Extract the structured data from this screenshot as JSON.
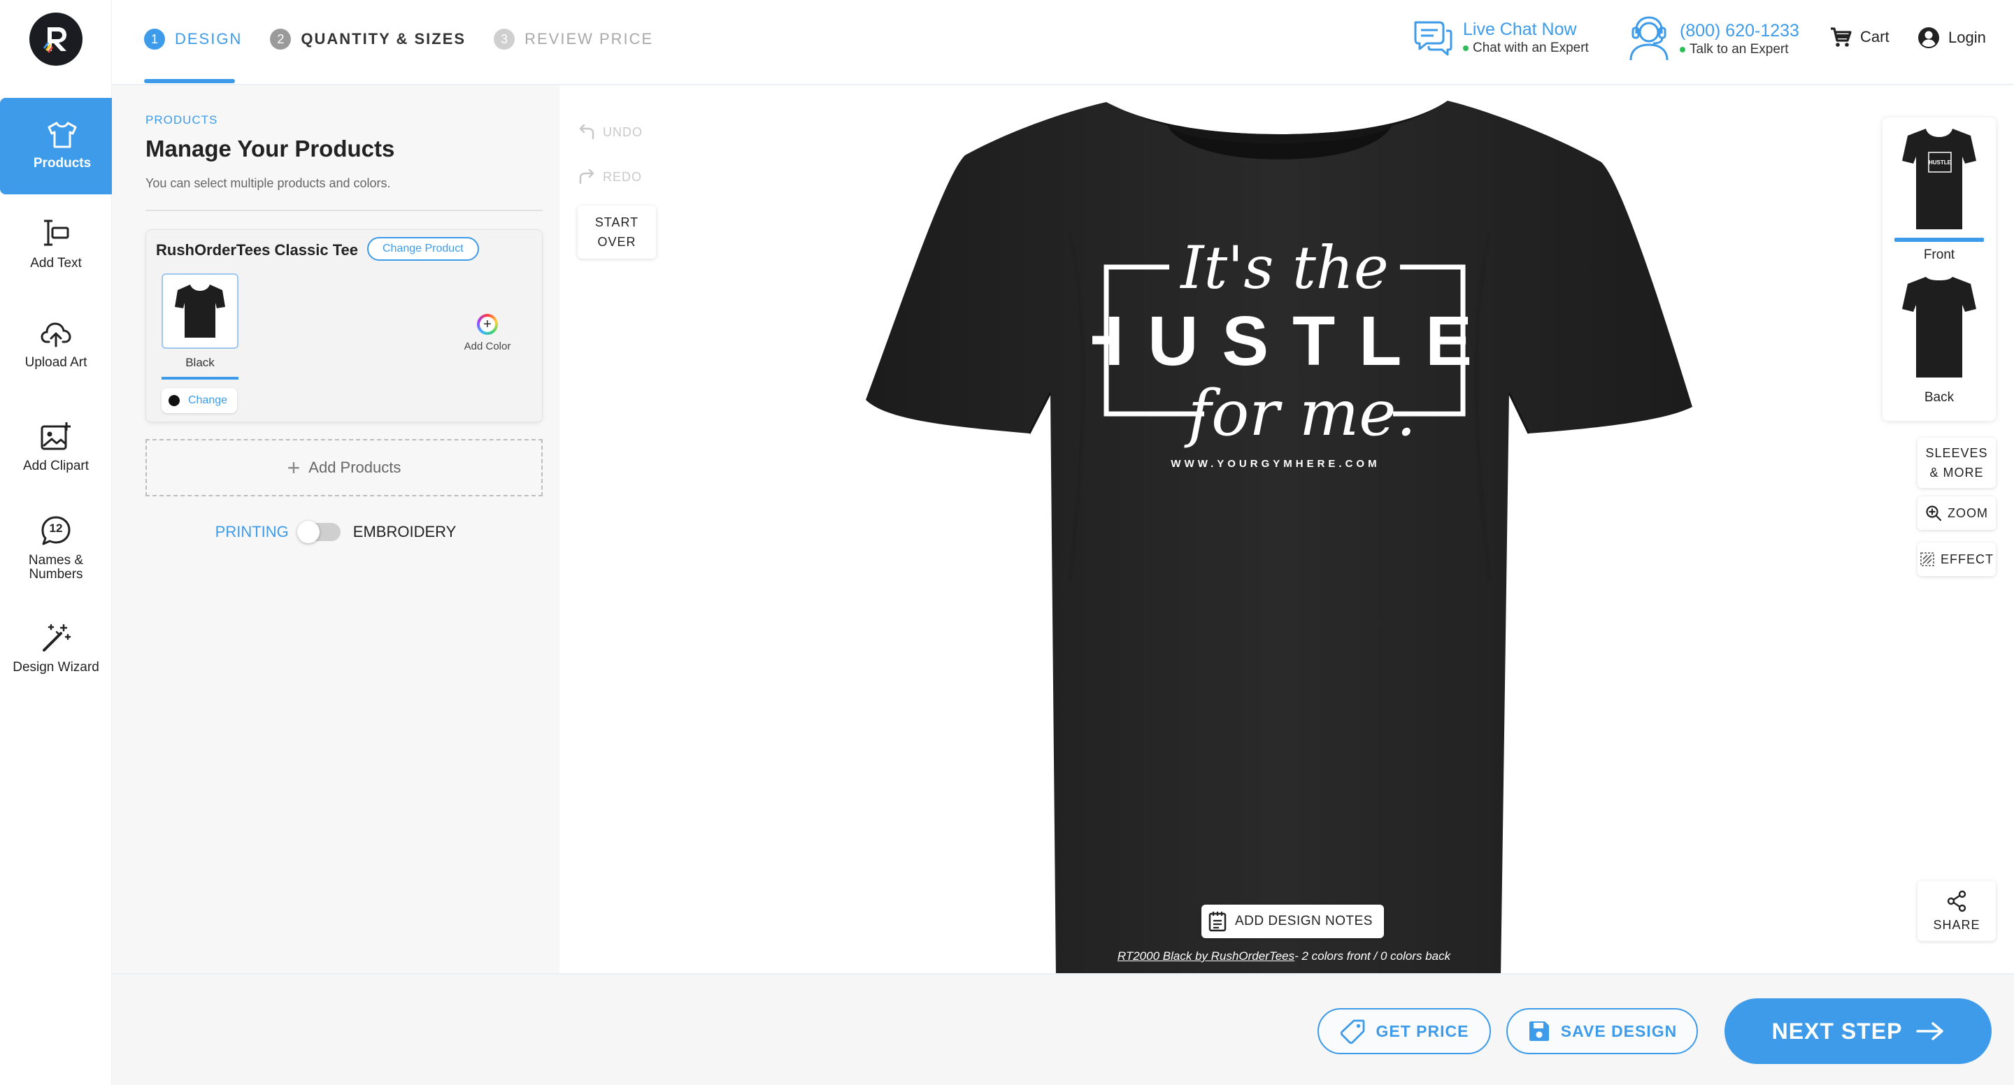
{
  "header": {
    "steps": [
      {
        "num": "1",
        "label": "DESIGN"
      },
      {
        "num": "2",
        "label": "QUANTITY & SIZES"
      },
      {
        "num": "3",
        "label": "REVIEW PRICE"
      }
    ],
    "chat": {
      "title": "Live Chat Now",
      "subtitle": "Chat with an Expert"
    },
    "phone": {
      "title": "(800) 620-1233",
      "subtitle": "Talk to an Expert"
    },
    "cart_label": "Cart",
    "login_label": "Login"
  },
  "sidebar": {
    "logo_letter": "R",
    "items": [
      {
        "label": "Products",
        "icon": "tshirt-icon"
      },
      {
        "label": "Add Text",
        "icon": "text-cursor-icon"
      },
      {
        "label": "Upload Art",
        "icon": "cloud-upload-icon"
      },
      {
        "label": "Add Clipart",
        "icon": "image-add-icon"
      },
      {
        "label": "Names & Numbers",
        "icon": "number-badge-icon",
        "badge": "12"
      },
      {
        "label": "Design Wizard",
        "icon": "magic-wand-icon"
      }
    ]
  },
  "panel": {
    "kicker": "PRODUCTS",
    "title": "Manage Your Products",
    "description": "You can select multiple products and colors.",
    "product": {
      "name": "RushOrderTees Classic Tee",
      "change_product_label": "Change Product",
      "color_name": "Black",
      "change_color_label": "Change",
      "add_color_label": "Add Color"
    },
    "add_products_label": "Add Products",
    "method": {
      "printing": "PRINTING",
      "embroidery": "EMBROIDERY"
    }
  },
  "toolbar": {
    "undo_label": "UNDO",
    "redo_label": "REDO",
    "start_over_line1": "START",
    "start_over_line2": "OVER"
  },
  "canvas": {
    "shirt_color": "#242424",
    "design_text": {
      "line1": "It's the",
      "line2": "HUSTLE",
      "line3": "for me.",
      "url": "WWW.YOURGYMHERE.COM"
    },
    "add_notes_label": "ADD DESIGN NOTES",
    "caption_link": "RT2000 Black by RushOrderTees",
    "caption_rest": "- 2 colors front  /  0 colors back"
  },
  "views": {
    "front_label": "Front",
    "back_label": "Back",
    "sleeves_line1": "SLEEVES",
    "sleeves_line2": "& MORE",
    "zoom_label": "ZOOM",
    "effect_label": "EFFECT",
    "share_label": "SHARE"
  },
  "footer": {
    "get_price_label": "GET PRICE",
    "save_design_label": "SAVE DESIGN",
    "next_step_label": "NEXT STEP"
  },
  "colors": {
    "accent": "#3d9bea",
    "online_dot": "#2ebd59"
  }
}
